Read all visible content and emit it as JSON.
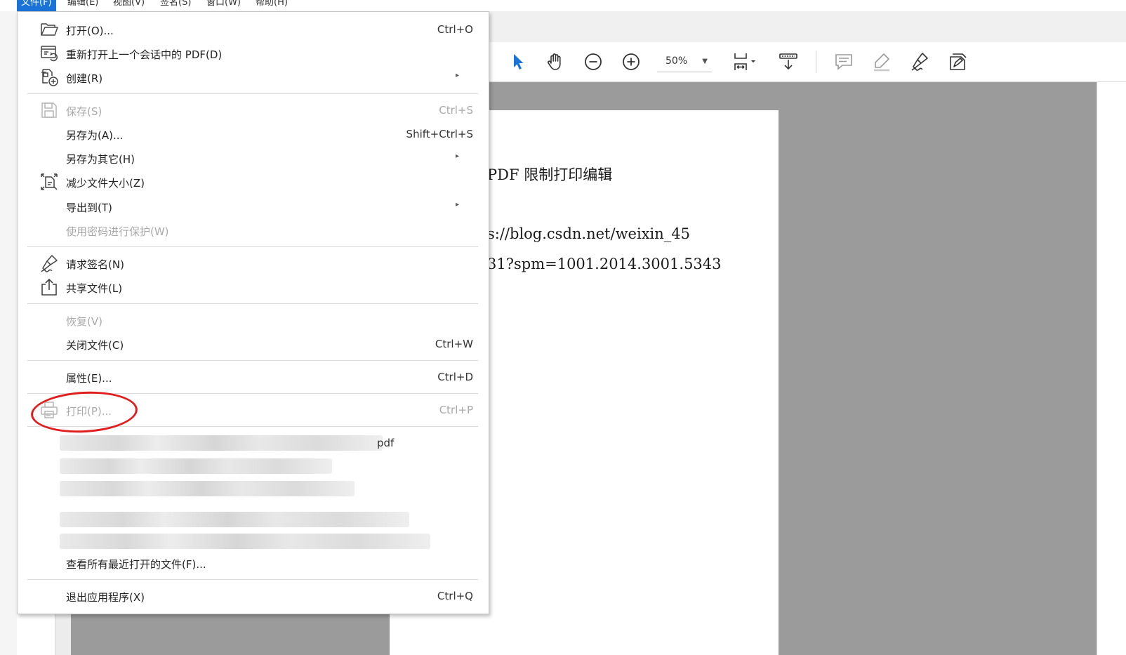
{
  "menubar": {
    "items": [
      "文件(F)",
      "编辑(E)",
      "视图(V)",
      "签名(S)",
      "窗口(W)",
      "帮助(H)"
    ]
  },
  "toolbar": {
    "zoom_value": "50%",
    "icons": [
      "select-arrow-icon",
      "hand-tool-icon",
      "zoom-out-icon",
      "zoom-in-icon",
      "page-fit-icon",
      "scroll-mode-icon",
      "comment-icon",
      "highlight-icon",
      "sign-icon",
      "fill-sign-icon"
    ],
    "accent_color": "#1a73d9"
  },
  "document": {
    "line1": "PDF 限制打印编辑",
    "line2": "s://blog.csdn.net/weixin_45",
    "line3": "31?spm=1001.2014.3001.5343"
  },
  "file_menu": {
    "open": {
      "label": "打开(O)...",
      "shortcut": "Ctrl+O"
    },
    "reopen": {
      "label": "重新打开上一个会话中的 PDF(D)"
    },
    "create": {
      "label": "创建(R)"
    },
    "save": {
      "label": "保存(S)",
      "shortcut": "Ctrl+S"
    },
    "save_as": {
      "label": "另存为(A)...",
      "shortcut": "Shift+Ctrl+S"
    },
    "save_as_other": {
      "label": "另存为其它(H)"
    },
    "reduce_size": {
      "label": "减少文件大小(Z)"
    },
    "export_to": {
      "label": "导出到(T)"
    },
    "protect_password": {
      "label": "使用密码进行保护(W)"
    },
    "request_signature": {
      "label": "请求签名(N)"
    },
    "share_file": {
      "label": "共享文件(L)"
    },
    "revert": {
      "label": "恢复(V)"
    },
    "close_file": {
      "label": "关闭文件(C)",
      "shortcut": "Ctrl+W"
    },
    "properties": {
      "label": "属性(E)...",
      "shortcut": "Ctrl+D"
    },
    "print": {
      "label": "打印(P)...",
      "shortcut": "Ctrl+P"
    },
    "recent_tail": "pdf",
    "view_all_recent": {
      "label": "查看所有最近打开的文件(F)..."
    },
    "exit": {
      "label": "退出应用程序(X)",
      "shortcut": "Ctrl+Q"
    },
    "submenu_arrow": "▸"
  },
  "annotation": {
    "color": "#e01e1e"
  }
}
